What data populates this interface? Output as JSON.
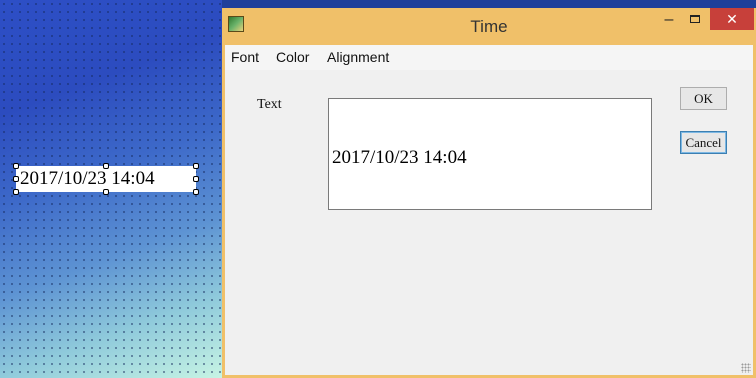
{
  "canvas": {
    "label_text": "2017/10/23 14:04"
  },
  "window": {
    "title": "Time",
    "controls": {
      "minimize": "–",
      "close": "✕"
    },
    "menu": [
      "Font",
      "Color",
      "Alignment"
    ]
  },
  "form": {
    "text_label": "Text",
    "text_value": "2017/10/23 14:04"
  },
  "buttons": {
    "ok": "OK",
    "cancel": "Cancel"
  },
  "colors": {
    "titlebar": "#f0c069",
    "close_button": "#c7403a"
  }
}
